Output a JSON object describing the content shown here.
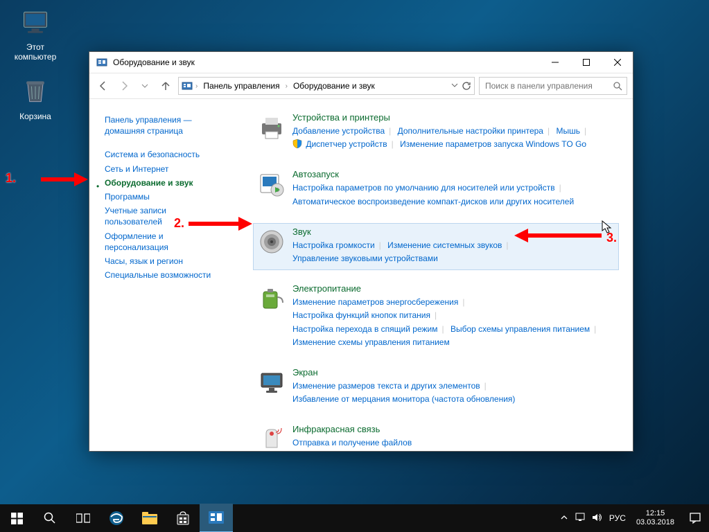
{
  "desktop": {
    "thisPc": "Этот компьютер",
    "recycleBin": "Корзина"
  },
  "window": {
    "title": "Оборудование и звук",
    "breadcrumb1": "Панель управления",
    "breadcrumb2": "Оборудование и звук",
    "searchPlaceholder": "Поиск в панели управления"
  },
  "sidebar": {
    "home1": "Панель управления —",
    "home2": "домашняя страница",
    "systemSecurity": "Система и безопасность",
    "network": "Сеть и Интернет",
    "hardware": "Оборудование и звук",
    "programs": "Программы",
    "accounts1": "Учетные записи",
    "accounts2": "пользователей",
    "appearance1": "Оформление и",
    "appearance2": "персонализация",
    "clock": "Часы, язык и регион",
    "ease": "Специальные возможности"
  },
  "cat": {
    "devices": {
      "title": "Устройства и принтеры",
      "addDevice": "Добавление устройства",
      "printerSettings": "Дополнительные настройки принтера",
      "mouse": "Мышь",
      "deviceManager": "Диспетчер устройств",
      "winToGo": "Изменение параметров запуска Windows TO Go"
    },
    "autoplay": {
      "title": "Автозапуск",
      "l1": "Настройка параметров по умолчанию для носителей или устройств",
      "l2": "Автоматическое воспроизведение компакт-дисков или других носителей"
    },
    "sound": {
      "title": "Звук",
      "volume": "Настройка громкости",
      "sysSounds": "Изменение системных звуков",
      "manage": "Управление звуковыми устройствами"
    },
    "power": {
      "title": "Электропитание",
      "l1": "Изменение параметров энергосбережения",
      "l2": "Настройка функций кнопок питания",
      "l3": "Настройка перехода в спящий режим",
      "l4": "Выбор схемы управления питанием",
      "l5": "Изменение схемы управления питанием"
    },
    "display": {
      "title": "Экран",
      "l1": "Изменение размеров текста и других элементов",
      "l2": "Избавление от мерцания монитора (частота обновления)"
    },
    "infrared": {
      "title": "Инфракрасная связь",
      "l1": "Отправка и получение файлов"
    }
  },
  "annot": {
    "n1": "1.",
    "n2": "2.",
    "n3": "3."
  },
  "tray": {
    "lang": "РУС",
    "time": "12:15",
    "date": "03.03.2018"
  }
}
